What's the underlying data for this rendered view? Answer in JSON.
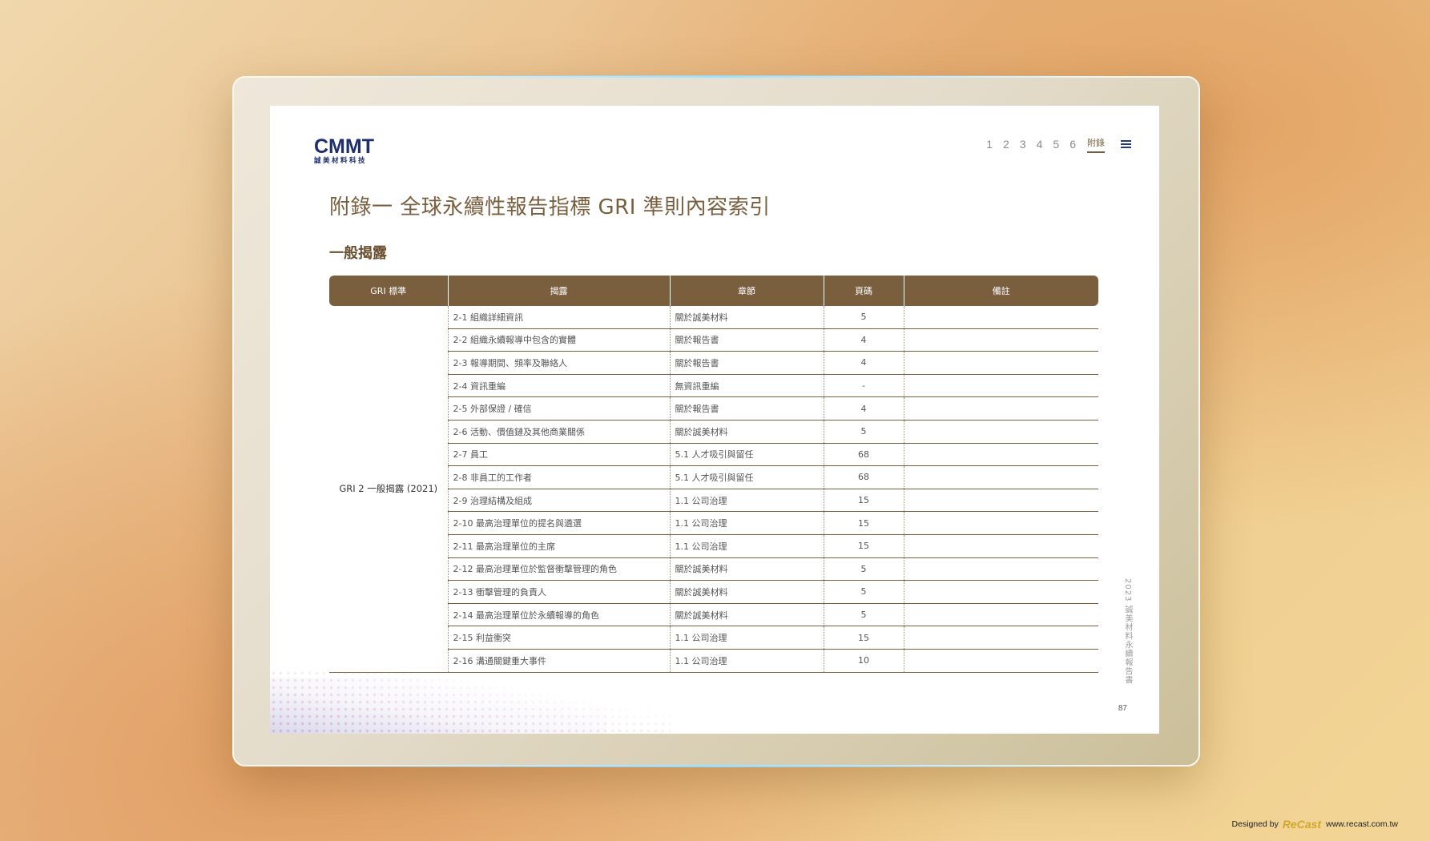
{
  "header": {
    "logo": {
      "main": "CMMT",
      "sub": "誠美材料科技"
    },
    "nav": {
      "items": [
        "1",
        "2",
        "3",
        "4",
        "5",
        "6"
      ],
      "active": "附錄"
    }
  },
  "page": {
    "title": "附錄一 全球永續性報告指標 GRI 準則內容索引",
    "subtitle": "一般揭露",
    "side_text": "2023 誠美材料永續報告書",
    "page_number": "87"
  },
  "table": {
    "headers": [
      "GRI 標準",
      "揭露",
      "章節",
      "頁碼",
      "備註"
    ],
    "standard": "GRI 2 一般揭露 (2021)",
    "rows": [
      {
        "disclosure": "2-1 組織詳細資訊",
        "section": "關於誠美材料",
        "page": "5",
        "note": ""
      },
      {
        "disclosure": "2-2 組織永續報導中包含的實體",
        "section": "關於報告書",
        "page": "4",
        "note": ""
      },
      {
        "disclosure": "2-3 報導期間、頻率及聯絡人",
        "section": "關於報告書",
        "page": "4",
        "note": ""
      },
      {
        "disclosure": "2-4 資訊重編",
        "section": "無資訊重編",
        "page": "-",
        "note": ""
      },
      {
        "disclosure": "2-5 外部保證 / 確信",
        "section": "關於報告書",
        "page": "4",
        "note": ""
      },
      {
        "disclosure": "2-6 活動、價值鏈及其他商業關係",
        "section": "關於誠美材料",
        "page": "5",
        "note": ""
      },
      {
        "disclosure": "2-7 員工",
        "section": "5.1 人才吸引與留任",
        "page": "68",
        "note": ""
      },
      {
        "disclosure": "2-8 非員工的工作者",
        "section": "5.1 人才吸引與留任",
        "page": "68",
        "note": ""
      },
      {
        "disclosure": "2-9 治理結構及組成",
        "section": "1.1 公司治理",
        "page": "15",
        "note": ""
      },
      {
        "disclosure": "2-10 最高治理單位的提名與遴選",
        "section": "1.1 公司治理",
        "page": "15",
        "note": ""
      },
      {
        "disclosure": "2-11 最高治理單位的主席",
        "section": "1.1 公司治理",
        "page": "15",
        "note": ""
      },
      {
        "disclosure": "2-12 最高治理單位於監督衝擊管理的角色",
        "section": "關於誠美材料",
        "page": "5",
        "note": ""
      },
      {
        "disclosure": "2-13 衝擊管理的負責人",
        "section": "關於誠美材料",
        "page": "5",
        "note": ""
      },
      {
        "disclosure": "2-14 最高治理單位於永續報導的角色",
        "section": "關於誠美材料",
        "page": "5",
        "note": ""
      },
      {
        "disclosure": "2-15 利益衝突",
        "section": "1.1 公司治理",
        "page": "15",
        "note": ""
      },
      {
        "disclosure": "2-16 溝通關鍵重大事件",
        "section": "1.1 公司治理",
        "page": "10",
        "note": ""
      }
    ]
  },
  "credit": {
    "prefix": "Designed by",
    "brand": "ReCast",
    "url": "www.recast.com.tw"
  },
  "colors": {
    "accent": "#7a5f3f",
    "logo": "#1f2f6e"
  }
}
